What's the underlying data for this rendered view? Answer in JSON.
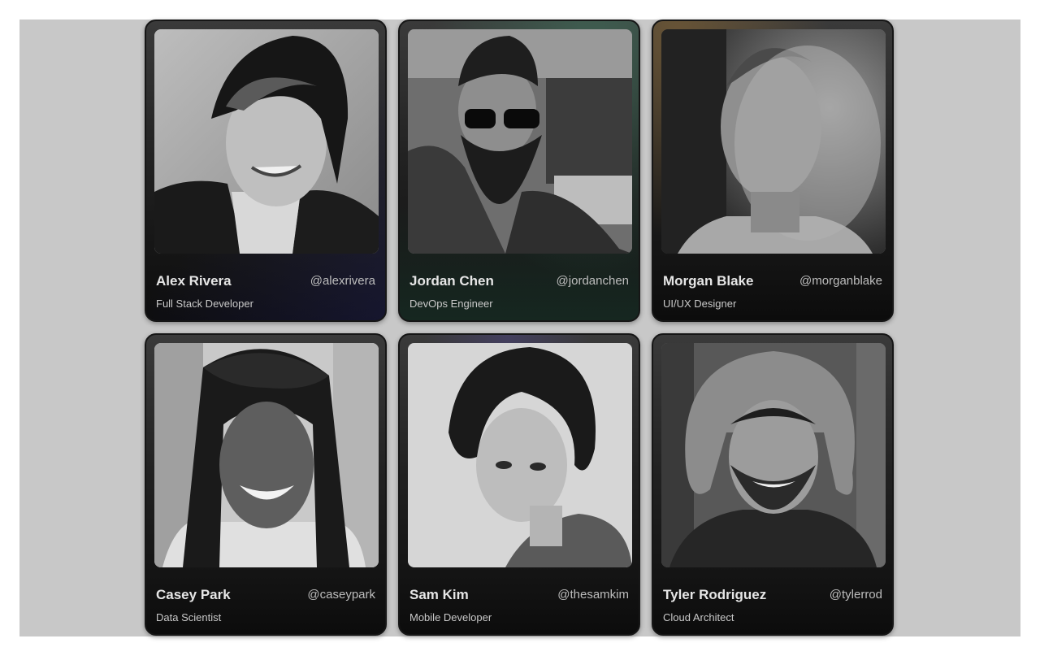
{
  "profiles": [
    {
      "name": "Alex Rivera",
      "handle": "@alexrivera",
      "role": "Full Stack Developer",
      "accent": "#2a2a5a"
    },
    {
      "name": "Jordan Chen",
      "handle": "@jordanchen",
      "role": "DevOps Engineer",
      "accent": "#2f5a4c"
    },
    {
      "name": "Morgan Blake",
      "handle": "@morganblake",
      "role": "UI/UX Designer",
      "accent": "#6b5530"
    },
    {
      "name": "Casey Park",
      "handle": "@caseypark",
      "role": "Data Scientist",
      "accent": "#2a2a2a"
    },
    {
      "name": "Sam Kim",
      "handle": "@thesamkim",
      "role": "Mobile Developer",
      "accent": "#3a3656"
    },
    {
      "name": "Tyler Rodriguez",
      "handle": "@tylerrod",
      "role": "Cloud Architect",
      "accent": "#2a2a2a"
    }
  ]
}
